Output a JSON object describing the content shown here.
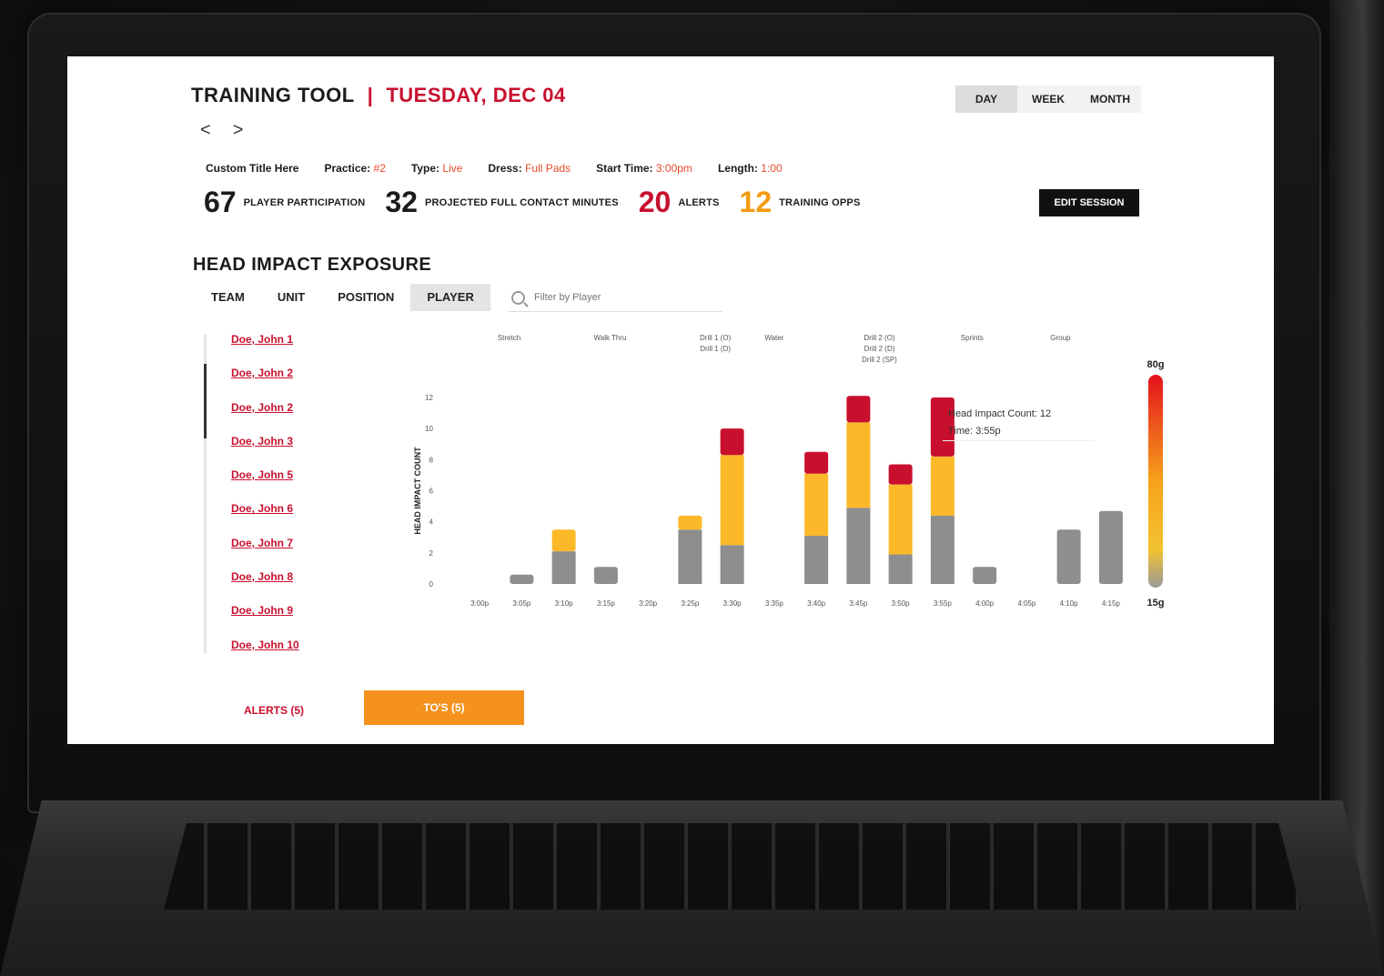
{
  "header": {
    "title": "TRAINING TOOL",
    "separator": "|",
    "date": "TUESDAY, DEC 04",
    "prev_arrow": "<",
    "next_arrow": ">"
  },
  "range_tabs": [
    {
      "label": "DAY",
      "active": true
    },
    {
      "label": "WEEK",
      "active": false
    },
    {
      "label": "MONTH",
      "active": false
    }
  ],
  "session_meta": {
    "title": "Custom Title Here",
    "practice_label": "Practice:",
    "practice_value": "#2",
    "type_label": "Type:",
    "type_value": "Live",
    "dress_label": "Dress:",
    "dress_value": "Full Pads",
    "start_label": "Start Time:",
    "start_value": "3:00pm",
    "length_label": "Length:",
    "length_value": "1:00"
  },
  "stats": {
    "participation_value": "67",
    "participation_label": "PLAYER PARTICIPATION",
    "contact_value": "32",
    "contact_label": "PROJECTED FULL CONTACT MINUTES",
    "alerts_value": "20",
    "alerts_label": "ALERTS",
    "training_value": "12",
    "training_label": "TRAINING OPPS"
  },
  "edit_button": "EDIT SESSION",
  "section": {
    "title": "HEAD IMPACT EXPOSURE",
    "view_tabs": [
      {
        "label": "TEAM",
        "active": false
      },
      {
        "label": "UNIT",
        "active": false
      },
      {
        "label": "POSITION",
        "active": false
      },
      {
        "label": "PLAYER",
        "active": true
      }
    ],
    "filter_placeholder": "Filter by Player"
  },
  "players": [
    "Doe, John 1",
    "Doe, John 2",
    "Doe, John 2",
    "Doe, John 3",
    "Doe, John 5",
    "Doe, John 6",
    "Doe, John 7",
    "Doe, John 8",
    "Doe, John 9",
    "Doe, John 10"
  ],
  "tooltip": {
    "line1": "Head Impact Count: 12",
    "line2": "Time: 3:55p"
  },
  "footer": {
    "alerts_button": "ALERTS (5)",
    "tos_button": "TO'S (5)"
  },
  "colors": {
    "red": "#c8102e",
    "orange": "#f5921e",
    "yellow": "#fbb829",
    "gray": "#8e8e8e",
    "black": "#111111"
  },
  "chart_data": {
    "type": "bar",
    "ylabel": "HEAD IMPACT COUNT",
    "ylim": [
      0,
      12
    ],
    "yticks": [
      0,
      2,
      4,
      6,
      8,
      10,
      12
    ],
    "categories": [
      "3:00p",
      "3:05p",
      "3:10p",
      "3:15p",
      "3:20p",
      "3:25p",
      "3:30p",
      "3:35p",
      "3:40p",
      "3:45p",
      "3:50p",
      "3:55p",
      "4:00p",
      "4:05p",
      "4:10p",
      "4:15p"
    ],
    "series": [
      {
        "values": [
          0,
          0.6,
          2.1,
          1.1,
          0,
          3.5,
          2.5,
          0,
          3.1,
          4.9,
          1.9,
          4.4,
          1.1,
          0,
          3.5,
          4.7
        ]
      },
      {
        "values": [
          0,
          0,
          1.4,
          0,
          0,
          0.9,
          5.8,
          0,
          4.0,
          5.5,
          4.5,
          3.8,
          0,
          0,
          0,
          0
        ]
      },
      {
        "values": [
          0,
          0,
          0,
          0,
          0,
          0,
          1.7,
          0,
          1.4,
          1.7,
          1.3,
          3.8,
          0,
          0,
          0,
          0
        ]
      }
    ],
    "phases": [
      {
        "label": "Stretch",
        "at": 1.2
      },
      {
        "label": "Walk Thru",
        "at": 3.6
      },
      {
        "label": "Drill 1 (O)\nDrill 1 (D)",
        "at": 6.1
      },
      {
        "label": "Water",
        "at": 7.5
      },
      {
        "label": "Drill 2 (O)\nDrill 2 (D)\nDrill 2 (SP)",
        "at": 10.0
      },
      {
        "label": "Sprints",
        "at": 12.2
      },
      {
        "label": "Group",
        "at": 14.3
      }
    ],
    "scale_legend": {
      "top": "80g",
      "bottom": "15g"
    }
  }
}
